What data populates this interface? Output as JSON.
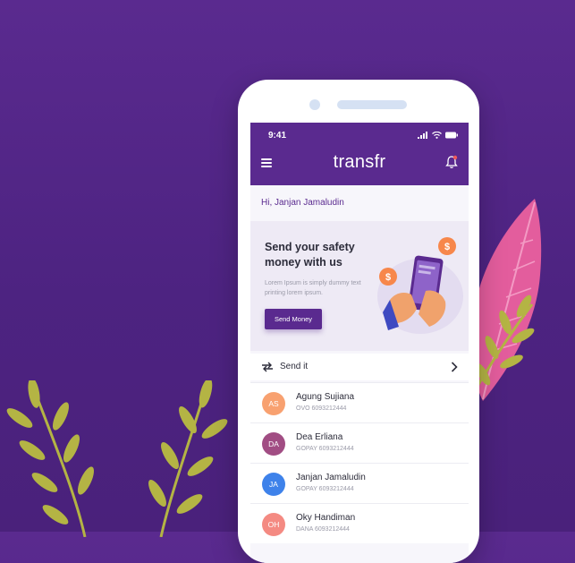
{
  "status_bar": {
    "time": "9:41"
  },
  "app": {
    "brand": "transfr"
  },
  "greeting": "Hi, Janjan Jamaludin",
  "promo": {
    "title": "Send your safety money with us",
    "description": "Lorem Ipsum is simply dummy text printing lorem ipsum.",
    "button_label": "Send Money",
    "coin_symbol": "$"
  },
  "send_section": {
    "label": "Send it"
  },
  "contacts": [
    {
      "initials": "AS",
      "name": "Agung Sujiana",
      "account": "OVO 6093212444",
      "color": "#f8a170"
    },
    {
      "initials": "DA",
      "name": "Dea Erliana",
      "account": "GOPAY 6093212444",
      "color": "#a14d83"
    },
    {
      "initials": "JA",
      "name": "Janjan Jamaludin",
      "account": "GOPAY 6093212444",
      "color": "#3e82ea"
    },
    {
      "initials": "OH",
      "name": "Oky Handiman",
      "account": "DANA 6093212444",
      "color": "#f48a82"
    }
  ],
  "colors": {
    "primary": "#5a2a8f",
    "background": "#4d2381",
    "leaf_pink": "#e35d9d",
    "leaf_olive": "#b4b444"
  }
}
